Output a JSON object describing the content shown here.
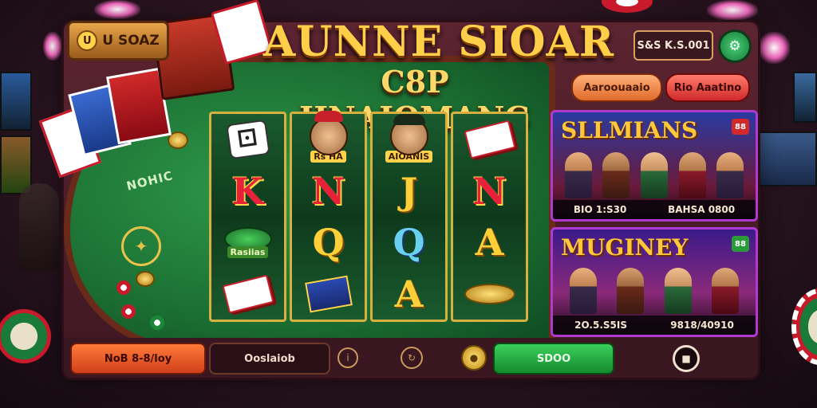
{
  "header": {
    "logo_text": "U SOAZ",
    "logo_coin": "U",
    "title_line1": "AUNNE SIOAR",
    "title_line2": "C8P HNAIOMANG",
    "balance": "S&S K.S.001",
    "settings_icon": "gear-icon",
    "pill_a": "Aaroouaaio",
    "pill_b": "Rio Aaatino"
  },
  "table": {
    "felt_text": "NOHIC"
  },
  "reels": [
    [
      {
        "kind": "icon",
        "icon": "dice-icon"
      },
      {
        "kind": "letter",
        "text": "K",
        "color": "red"
      },
      {
        "kind": "icon",
        "icon": "hat-icon",
        "label": "Rasiias"
      },
      {
        "kind": "icon",
        "icon": "card-icon"
      }
    ],
    [
      {
        "kind": "face",
        "icon": "woman-face-icon",
        "label": "Rs HA"
      },
      {
        "kind": "letter",
        "text": "N",
        "color": "red"
      },
      {
        "kind": "letter",
        "text": "Q",
        "color": "gold"
      },
      {
        "kind": "icon",
        "icon": "book-icon"
      }
    ],
    [
      {
        "kind": "face",
        "icon": "man-face-icon",
        "label": "AIOANIS"
      },
      {
        "kind": "letter",
        "text": "J",
        "color": "gold"
      },
      {
        "kind": "letter",
        "text": "Q",
        "color": "cyan"
      },
      {
        "kind": "letter",
        "text": "A",
        "color": "gold"
      }
    ],
    [
      {
        "kind": "icon",
        "icon": "card-icon"
      },
      {
        "kind": "letter",
        "text": "N",
        "color": "red"
      },
      {
        "kind": "letter",
        "text": "A",
        "color": "gold"
      },
      {
        "kind": "icon",
        "icon": "coin-icon"
      }
    ]
  ],
  "promos": [
    {
      "title": "SLLMIANS",
      "badge": "88",
      "stat_left": "BIO 1:S30",
      "stat_right": "BAHSA 0800"
    },
    {
      "title": "MUGINEY",
      "badge": "88",
      "stat_left": "2O.5.S5IS",
      "stat_right": "9818/40910"
    }
  ],
  "bottom_bar": {
    "bet_label": "NoB 8-8/loy",
    "autoplay_label": "Ooslaiob",
    "info_icon": "info-icon",
    "turbo_icon": "turbo-icon",
    "coin_icon": "coin-icon",
    "spin_label": "SDOO",
    "stop_icon": "stop-icon"
  },
  "colors": {
    "felt": "#1b6e32",
    "gold": "#ffcf4a",
    "panel": "#5b2430",
    "spin": "#3ad05a",
    "bet": "#ff7a3a"
  }
}
